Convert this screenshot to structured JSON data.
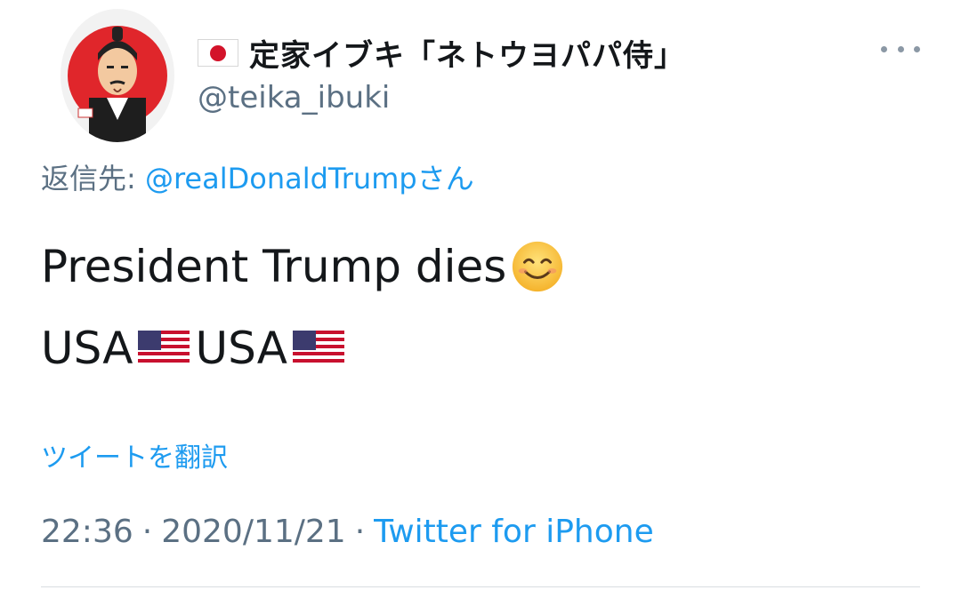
{
  "author": {
    "name_flag_icon": "japan-flag-icon",
    "display_name": "定家イブキ「ネトウヨパパ侍」",
    "handle": "@teika_ibuki"
  },
  "reply": {
    "label": "返信先:",
    "handle": "@realDonaldTrumpさん"
  },
  "tweet": {
    "line1_text": "President Trump dies",
    "line1_emoji": "smiling-face-emoji",
    "line2_part1": "USA",
    "line2_part2": "USA",
    "line2_flag_icon": "usa-flag-icon"
  },
  "translate_label": "ツイートを翻訳",
  "meta": {
    "time": "22:36",
    "separator": "·",
    "date": "2020/11/21",
    "source": "Twitter for iPhone"
  },
  "colors": {
    "link": "#1d9bf0",
    "muted": "#5b7083",
    "text": "#14171a",
    "avatar_red": "#e0262b"
  }
}
